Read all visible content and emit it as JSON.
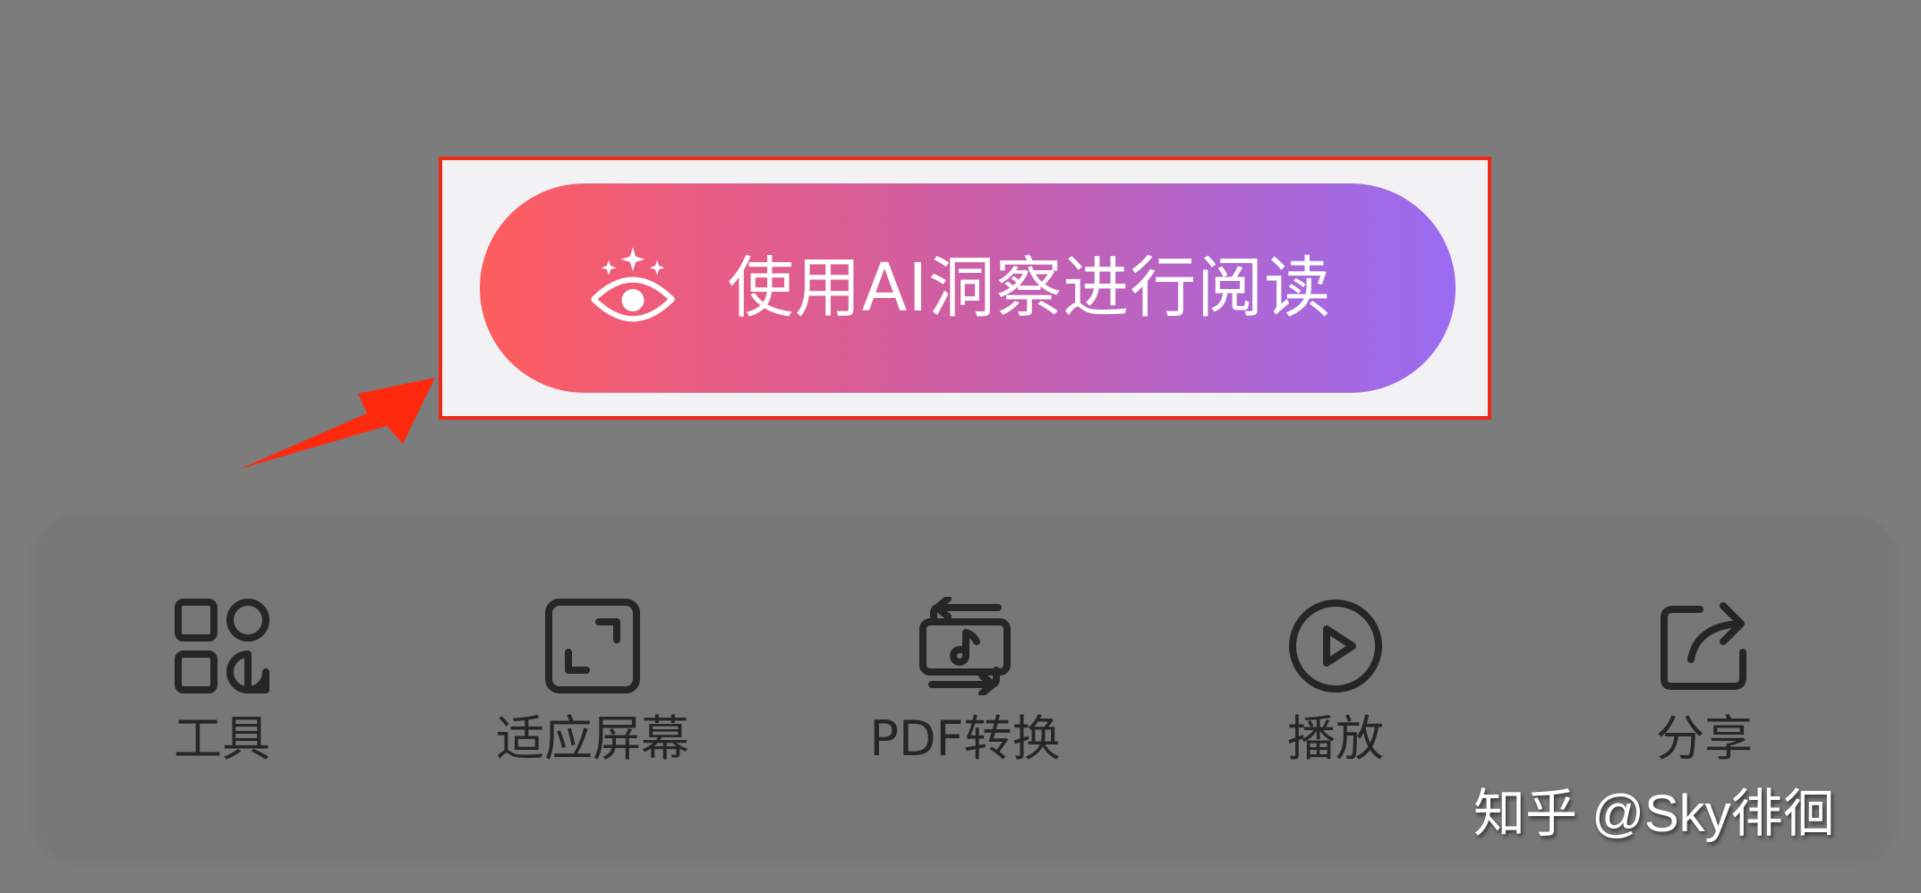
{
  "ai_button": {
    "label": "使用AI洞察进行阅读",
    "icon": "sparkle-eye-icon"
  },
  "toolbar": {
    "items": [
      {
        "label": "工具",
        "icon": "grid-tools-icon"
      },
      {
        "label": "适应屏幕",
        "icon": "fit-screen-icon"
      },
      {
        "label": "PDF转换",
        "icon": "pdf-convert-icon"
      },
      {
        "label": "播放",
        "icon": "play-icon"
      },
      {
        "label": "分享",
        "icon": "share-icon"
      }
    ]
  },
  "watermark": {
    "text": "知乎 @Sky徘徊"
  },
  "colors": {
    "highlight_border": "#ee2a14",
    "button_gradient_start": "#ff5d5d",
    "button_gradient_end": "#9a6cf2",
    "overlay": "#7c7c7c"
  }
}
